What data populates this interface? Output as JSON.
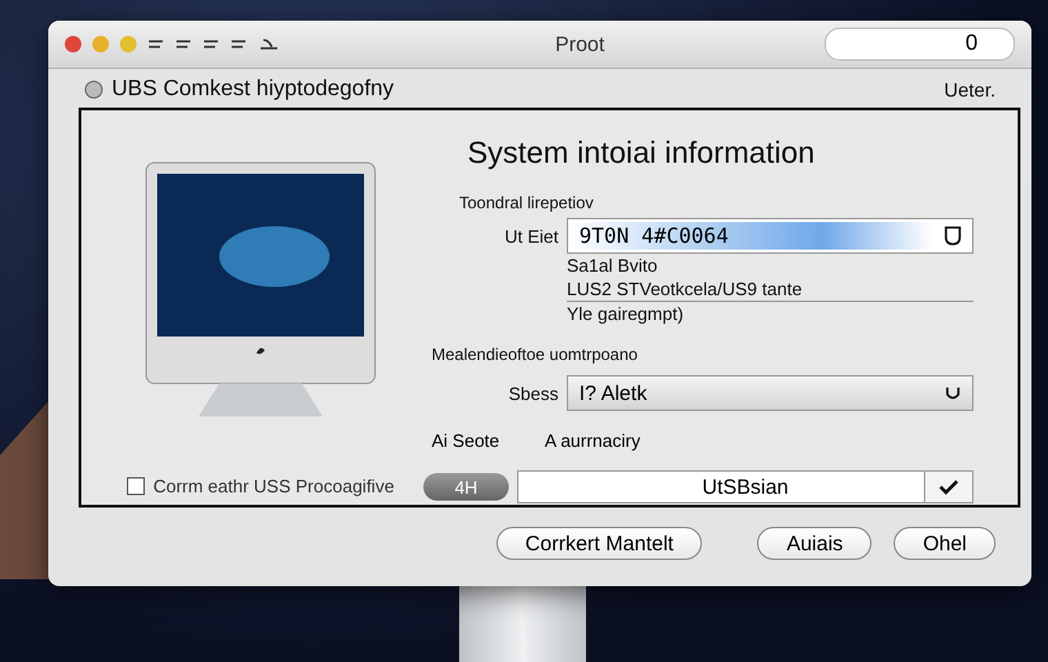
{
  "window": {
    "title": "Proot"
  },
  "search": {
    "value": "0"
  },
  "header": {
    "title": "UBS Comkest hiyptodegofny",
    "right": "Ueter."
  },
  "panel": {
    "heading": "System intoiai information",
    "section_1": "Toondral lirepetiov",
    "id_field": {
      "label": "Ut Eiet",
      "value": "9T0N 4#C0064",
      "level": 0.9
    },
    "lines": [
      "Sa1al Bvito",
      "LUS2 STVeotkcela/US9 tante",
      "Yle gairegmpt)"
    ],
    "section_2": "Mealendieoftoe uomtrpoano",
    "dropdown": {
      "label": "Sbess",
      "value": "I? Aletk"
    },
    "row": {
      "label": "Ai Seote",
      "value": "A aurrnaciry"
    },
    "pill": "4H",
    "select": {
      "value": "UtSBsian",
      "checked": true
    },
    "checkbox": {
      "label": "Corrm eathr USS Procoagifive",
      "checked": false
    }
  },
  "buttons": [
    {
      "label": "Corrkert Mantelt",
      "selected": false
    },
    {
      "label": "Auiais",
      "selected": false
    },
    {
      "label": "Ohel",
      "selected": false
    }
  ]
}
